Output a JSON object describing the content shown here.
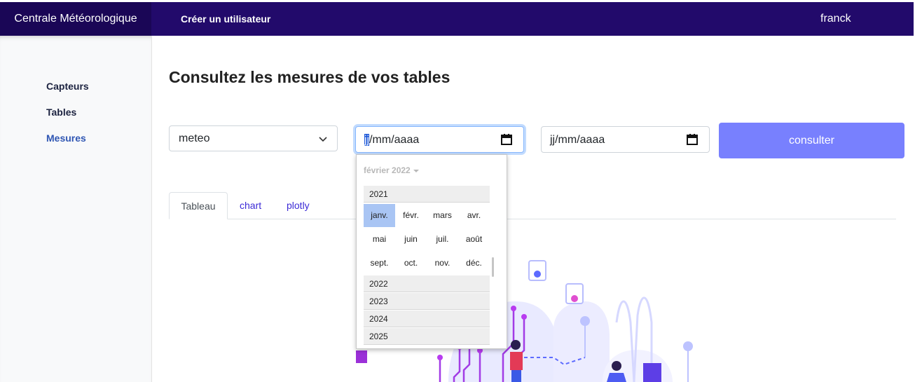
{
  "header": {
    "brand": "Centrale Météorologique",
    "create_user": "Créer un utilisateur",
    "user": "franck"
  },
  "sidebar": {
    "items": [
      {
        "label": "Capteurs"
      },
      {
        "label": "Tables"
      },
      {
        "label": "Mesures"
      }
    ],
    "active": "Mesures"
  },
  "main": {
    "title": "Consultez les mesures de vos tables",
    "table_select": {
      "value": "meteo",
      "icon": "chevron-down-icon"
    },
    "date_from": {
      "placeholder_day": "jj",
      "placeholder_rest": "/mm/aaaa",
      "icon": "calendar-icon"
    },
    "date_to": {
      "placeholder": "jj/mm/aaaa",
      "icon": "calendar-icon"
    },
    "submit_label": "consulter",
    "tabs": [
      {
        "label": "Tableau"
      },
      {
        "label": "chart"
      },
      {
        "label": "plotly"
      }
    ]
  },
  "datepicker": {
    "header": "février 2022",
    "years": [
      "2021",
      "2022",
      "2023",
      "2024",
      "2025"
    ],
    "months": [
      "janv.",
      "févr.",
      "mars",
      "avr.",
      "mai",
      "juin",
      "juil.",
      "août",
      "sept.",
      "oct.",
      "nov.",
      "déc."
    ],
    "selected_month": "janv."
  },
  "colors": {
    "topbar": "#220a6b",
    "brand_bg": "#1a0656",
    "accent": "#7880fe",
    "link": "#3c2bd6"
  }
}
